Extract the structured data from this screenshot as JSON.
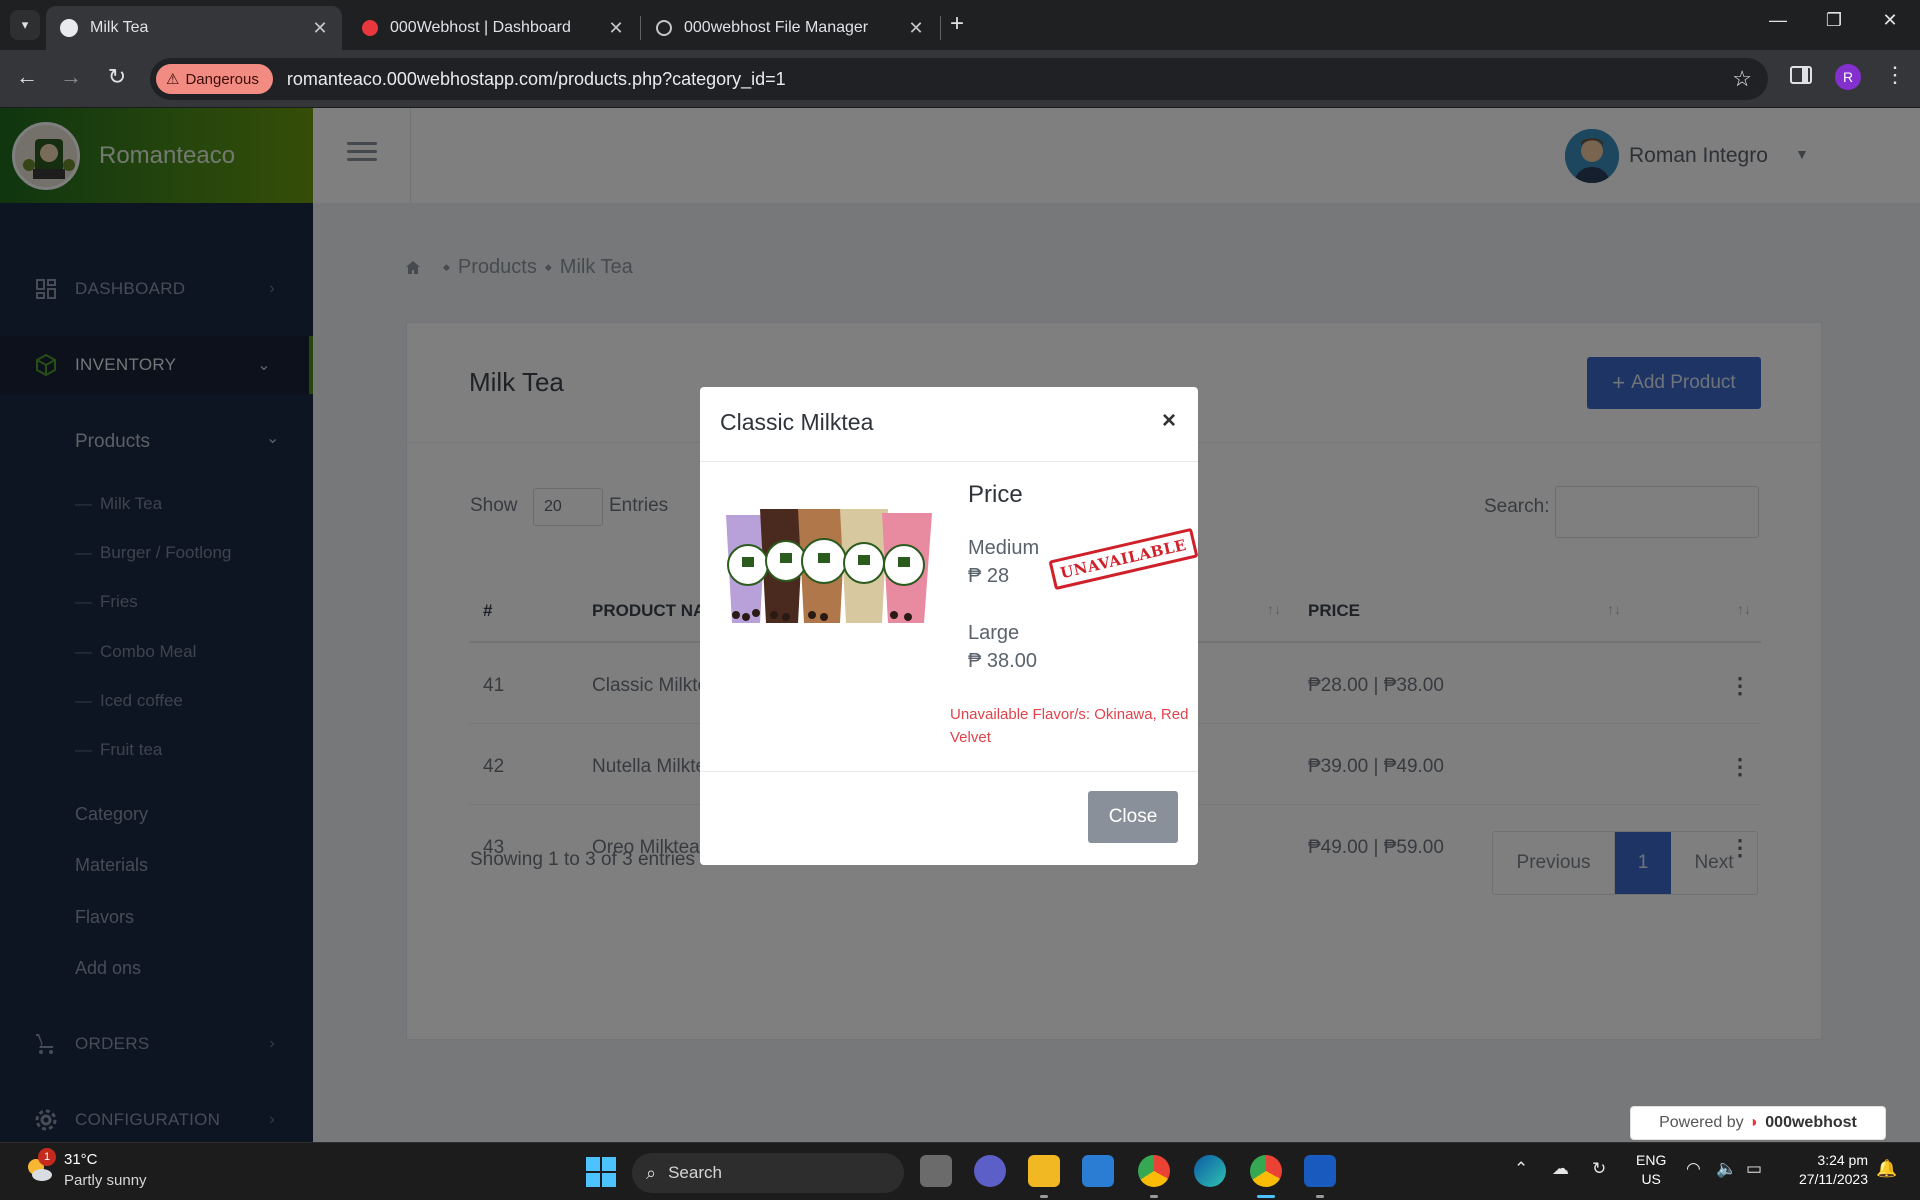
{
  "browser": {
    "tabs": [
      {
        "title": "Milk Tea",
        "active": true
      },
      {
        "title": "000Webhost | Dashboard",
        "active": false
      },
      {
        "title": "000webhost File Manager",
        "active": false
      }
    ],
    "security_label": "Dangerous",
    "url": "romanteaco.000webhostapp.com/products.php?category_id=1",
    "profile_initial": "R"
  },
  "sidebar": {
    "brand": "Romanteaco",
    "nav": {
      "dashboard": "DASHBOARD",
      "inventory": "INVENTORY",
      "products": "Products",
      "orders": "ORDERS",
      "configuration": "CONFIGURATION"
    },
    "product_categories": [
      "Milk Tea",
      "Burger / Footlong",
      "Fries",
      "Combo Meal",
      "Iced coffee",
      "Fruit tea"
    ],
    "links": [
      "Category",
      "Materials",
      "Flavors",
      "Add ons"
    ]
  },
  "topbar": {
    "user_name": "Roman Integro"
  },
  "breadcrumb": {
    "items": [
      "Products",
      "Milk Tea"
    ]
  },
  "main": {
    "title": "Milk Tea",
    "add_button": "Add Product",
    "show_label": "Show",
    "show_value": "20",
    "entries_label": "Entries",
    "search_label": "Search:",
    "columns": [
      "#",
      "PRODUCT NA",
      "PRICE"
    ],
    "rows": [
      {
        "id": "41",
        "name": "Classic Milkte",
        "price": "₱28.00 | ₱38.00"
      },
      {
        "id": "42",
        "name": "Nutella Milkte",
        "price": "₱39.00 | ₱49.00"
      },
      {
        "id": "43",
        "name": "Oreo Milktea",
        "price": "₱49.00 | ₱59.00"
      }
    ],
    "showing": "Showing 1 to 3 of 3 entries",
    "pager": {
      "previous": "Previous",
      "current": "1",
      "next": "Next"
    }
  },
  "modal": {
    "title": "Classic Milktea",
    "close_x": "×",
    "price_heading": "Price",
    "sizes": [
      {
        "label": "Medium",
        "price": "₱ 28"
      },
      {
        "label": "Large",
        "price": "₱ 38.00"
      }
    ],
    "stamp": "UNAVAILABLE",
    "unavailable_note": "Unavailable Flavor/s: Okinawa, Red Velvet",
    "close_button": "Close"
  },
  "powered": {
    "prefix": "Powered by",
    "brand": "000webhost"
  },
  "taskbar": {
    "weather_badge": "1",
    "temperature": "31°C",
    "condition": "Partly sunny",
    "search_placeholder": "Search",
    "lang_line1": "ENG",
    "lang_line2": "US",
    "time": "3:24 pm",
    "date": "27/11/2023"
  },
  "colors": {
    "sidebar_bg": "#1d2b45",
    "brand_green": "#4d8c1a",
    "primary_blue": "#3b69c9",
    "danger_red": "#e0434b"
  }
}
